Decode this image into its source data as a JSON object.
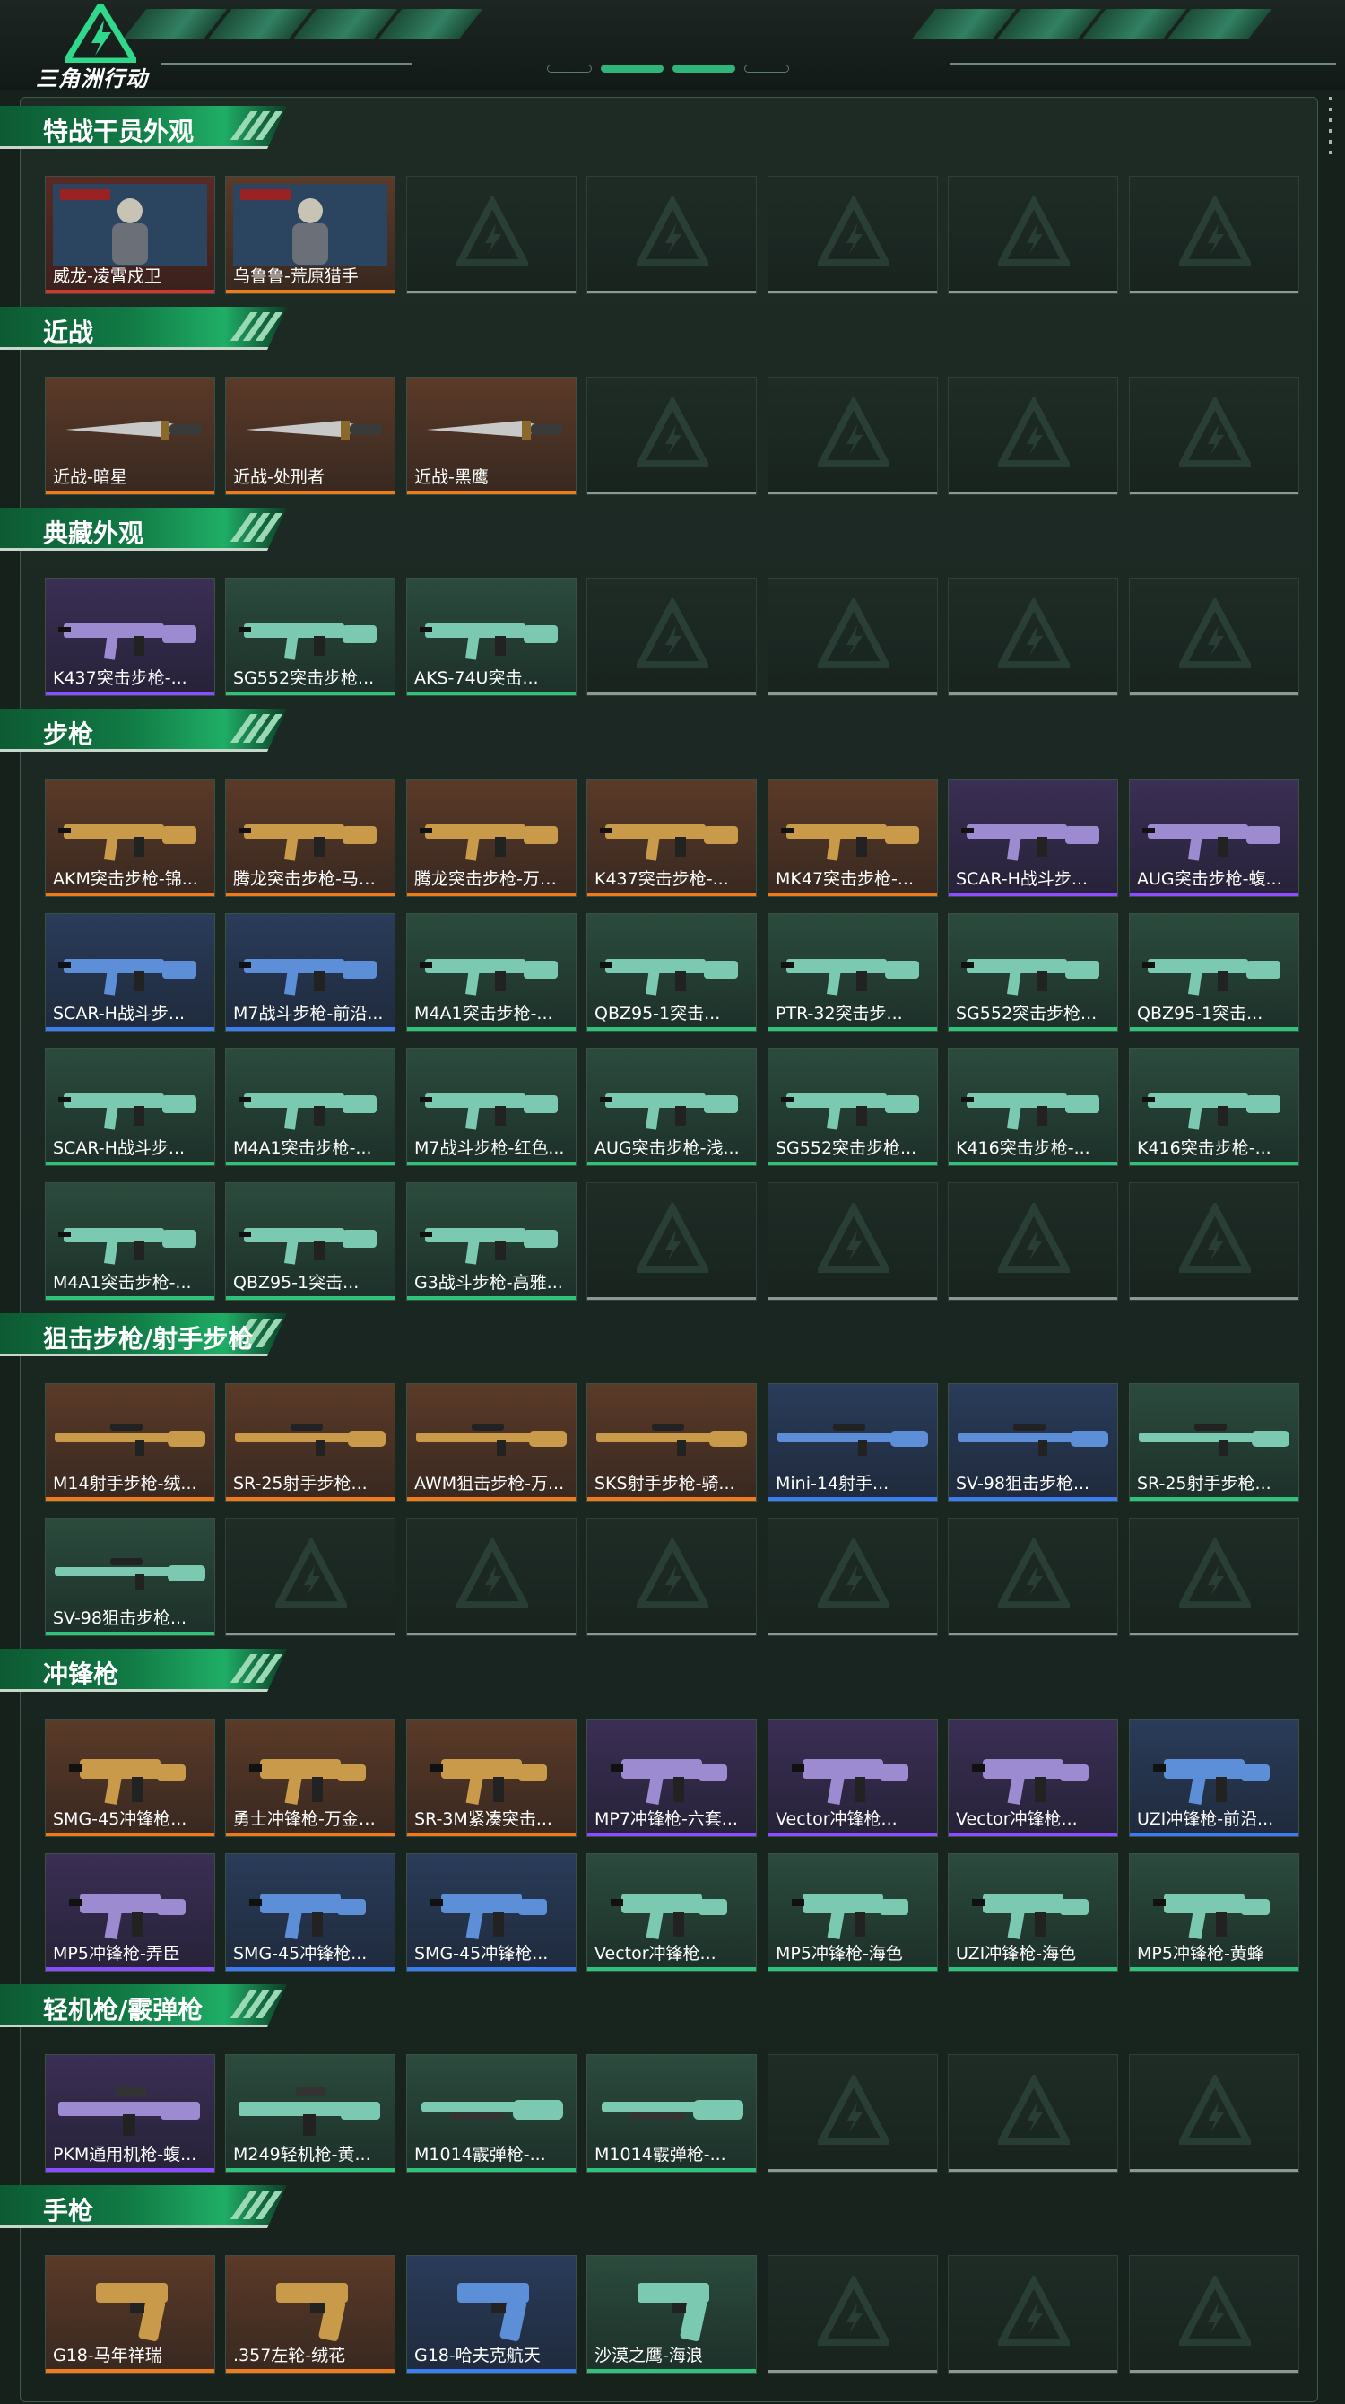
{
  "app": {
    "logo_text": "三角洲行动"
  },
  "colors": {
    "red": "#d8322b",
    "orange": "#f07a18",
    "purple": "#8b4dff",
    "blue": "#3b7cf2",
    "green": "#2fc27a",
    "empty": "#8c9892"
  },
  "sections": [
    {
      "title": "特战干员外观",
      "items": [
        {
          "name": "威龙-凌霄戍卫",
          "rarity": "red",
          "icon": "operator-skin-icon"
        },
        {
          "name": "乌鲁鲁-荒原猎手",
          "rarity": "orange",
          "icon": "operator-skin-icon"
        },
        null,
        null,
        null,
        null,
        null
      ]
    },
    {
      "title": "近战",
      "items": [
        {
          "name": "近战-暗星",
          "rarity": "orange",
          "icon": "knife-icon"
        },
        {
          "name": "近战-处刑者",
          "rarity": "orange",
          "icon": "knife-icon"
        },
        {
          "name": "近战-黑鹰",
          "rarity": "orange",
          "icon": "knife-icon"
        },
        null,
        null,
        null,
        null
      ]
    },
    {
      "title": "典藏外观",
      "items": [
        {
          "name": "K437突击步枪-...",
          "rarity": "purple",
          "icon": "rifle-icon"
        },
        {
          "name": "SG552突击步枪...",
          "rarity": "green",
          "icon": "rifle-icon"
        },
        {
          "name": "AKS-74U突击...",
          "rarity": "green",
          "icon": "rifle-icon"
        },
        null,
        null,
        null,
        null
      ]
    },
    {
      "title": "步枪",
      "items": [
        {
          "name": "AKM突击步枪-锦...",
          "rarity": "orange",
          "icon": "rifle-icon"
        },
        {
          "name": "腾龙突击步枪-马年...",
          "rarity": "orange",
          "icon": "rifle-icon"
        },
        {
          "name": "腾龙突击步枪-万金...",
          "rarity": "orange",
          "icon": "rifle-icon"
        },
        {
          "name": "K437突击步枪-...",
          "rarity": "orange",
          "icon": "rifle-icon"
        },
        {
          "name": "MK47突击步枪-...",
          "rarity": "orange",
          "icon": "rifle-icon"
        },
        {
          "name": "SCAR-H战斗步...",
          "rarity": "purple",
          "icon": "rifle-icon"
        },
        {
          "name": "AUG突击步枪-蝮...",
          "rarity": "purple",
          "icon": "rifle-icon"
        },
        {
          "name": "SCAR-H战斗步...",
          "rarity": "blue",
          "icon": "rifle-icon"
        },
        {
          "name": "M7战斗步枪-前沿...",
          "rarity": "blue",
          "icon": "rifle-icon"
        },
        {
          "name": "M4A1突击步枪-...",
          "rarity": "green",
          "icon": "rifle-icon"
        },
        {
          "name": "QBZ95-1突击...",
          "rarity": "green",
          "icon": "rifle-icon"
        },
        {
          "name": "PTR-32突击步...",
          "rarity": "green",
          "icon": "rifle-icon"
        },
        {
          "name": "SG552突击步枪...",
          "rarity": "green",
          "icon": "rifle-icon"
        },
        {
          "name": "QBZ95-1突击...",
          "rarity": "green",
          "icon": "rifle-icon"
        },
        {
          "name": "SCAR-H战斗步...",
          "rarity": "green",
          "icon": "rifle-icon"
        },
        {
          "name": "M4A1突击步枪-...",
          "rarity": "green",
          "icon": "rifle-icon"
        },
        {
          "name": "M7战斗步枪-红色...",
          "rarity": "green",
          "icon": "rifle-icon"
        },
        {
          "name": "AUG突击步枪-浅...",
          "rarity": "green",
          "icon": "rifle-icon"
        },
        {
          "name": "SG552突击步枪...",
          "rarity": "green",
          "icon": "rifle-icon"
        },
        {
          "name": "K416突击步枪-...",
          "rarity": "green",
          "icon": "rifle-icon"
        },
        {
          "name": "K416突击步枪-...",
          "rarity": "green",
          "icon": "rifle-icon"
        },
        {
          "name": "M4A1突击步枪-...",
          "rarity": "green",
          "icon": "rifle-icon"
        },
        {
          "name": "QBZ95-1突击...",
          "rarity": "green",
          "icon": "rifle-icon"
        },
        {
          "name": "G3战斗步枪-高雅...",
          "rarity": "green",
          "icon": "rifle-icon"
        },
        null,
        null,
        null,
        null
      ]
    },
    {
      "title": "狙击步枪/射手步枪",
      "items": [
        {
          "name": "M14射手步枪-绒...",
          "rarity": "orange",
          "icon": "sniper-icon"
        },
        {
          "name": "SR-25射手步枪...",
          "rarity": "orange",
          "icon": "sniper-icon"
        },
        {
          "name": "AWM狙击步枪-万...",
          "rarity": "orange",
          "icon": "sniper-icon"
        },
        {
          "name": "SKS射手步枪-骑...",
          "rarity": "orange",
          "icon": "sniper-icon"
        },
        {
          "name": "Mini-14射手...",
          "rarity": "blue",
          "icon": "sniper-icon"
        },
        {
          "name": "SV-98狙击步枪...",
          "rarity": "blue",
          "icon": "sniper-icon"
        },
        {
          "name": "SR-25射手步枪...",
          "rarity": "green",
          "icon": "sniper-icon"
        },
        {
          "name": "SV-98狙击步枪...",
          "rarity": "green",
          "icon": "sniper-icon"
        },
        null,
        null,
        null,
        null,
        null,
        null
      ]
    },
    {
      "title": "冲锋枪",
      "items": [
        {
          "name": "SMG-45冲锋枪...",
          "rarity": "orange",
          "icon": "smg-icon"
        },
        {
          "name": "勇士冲锋枪-万金泪...",
          "rarity": "orange",
          "icon": "smg-icon"
        },
        {
          "name": "SR-3M紧凑突击...",
          "rarity": "orange",
          "icon": "smg-icon"
        },
        {
          "name": "MP7冲锋枪-六套...",
          "rarity": "purple",
          "icon": "smg-icon"
        },
        {
          "name": "Vector冲锋枪...",
          "rarity": "purple",
          "icon": "smg-icon"
        },
        {
          "name": "Vector冲锋枪...",
          "rarity": "purple",
          "icon": "smg-icon"
        },
        {
          "name": "UZI冲锋枪-前沿...",
          "rarity": "blue",
          "icon": "smg-icon"
        },
        {
          "name": "MP5冲锋枪-弄臣",
          "rarity": "purple",
          "icon": "smg-icon"
        },
        {
          "name": "SMG-45冲锋枪...",
          "rarity": "blue",
          "icon": "smg-icon"
        },
        {
          "name": "SMG-45冲锋枪...",
          "rarity": "blue",
          "icon": "smg-icon"
        },
        {
          "name": "Vector冲锋枪...",
          "rarity": "green",
          "icon": "smg-icon"
        },
        {
          "name": "MP5冲锋枪-海色",
          "rarity": "green",
          "icon": "smg-icon"
        },
        {
          "name": "UZI冲锋枪-海色",
          "rarity": "green",
          "icon": "smg-icon"
        },
        {
          "name": "MP5冲锋枪-黄蜂",
          "rarity": "green",
          "icon": "smg-icon"
        }
      ]
    },
    {
      "title": "轻机枪/霰弹枪",
      "items": [
        {
          "name": "PKM通用机枪-蝮...",
          "rarity": "purple",
          "icon": "lmg-icon"
        },
        {
          "name": "M249轻机枪-黄...",
          "rarity": "green",
          "icon": "lmg-icon"
        },
        {
          "name": "M1014霰弹枪-...",
          "rarity": "green",
          "icon": "shotgun-icon"
        },
        {
          "name": "M1014霰弹枪-...",
          "rarity": "green",
          "icon": "shotgun-icon"
        },
        null,
        null,
        null
      ]
    },
    {
      "title": "手枪",
      "items": [
        {
          "name": "G18-马年祥瑞",
          "rarity": "orange",
          "icon": "pistol-icon"
        },
        {
          "name": ".357左轮-绒花",
          "rarity": "orange",
          "icon": "pistol-icon"
        },
        {
          "name": "G18-哈夫克航天",
          "rarity": "blue",
          "icon": "pistol-icon"
        },
        {
          "name": "沙漠之鹰-海浪",
          "rarity": "green",
          "icon": "pistol-icon"
        },
        null,
        null,
        null
      ]
    }
  ]
}
